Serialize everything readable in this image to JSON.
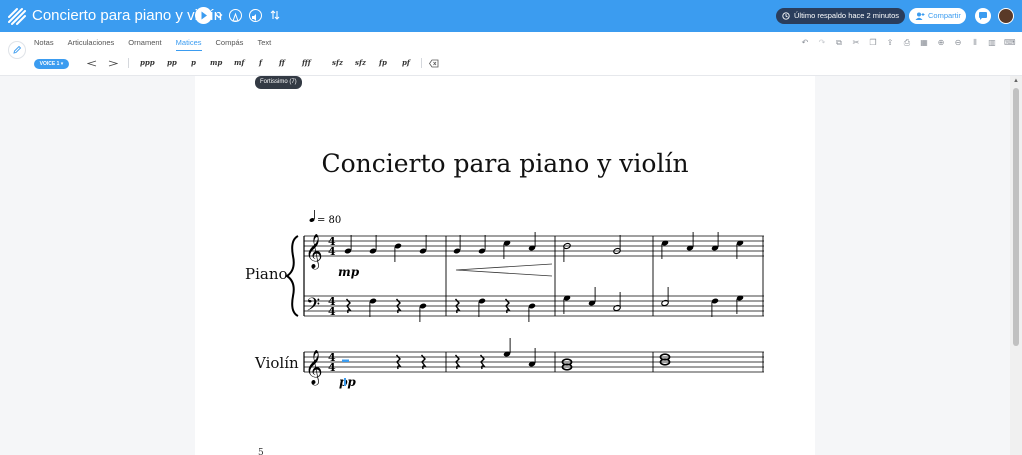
{
  "app": {
    "document_title": "Concierto para piano y violín",
    "backup_status": "Último respaldo hace 2 minutos",
    "share_label": "Compartir"
  },
  "toolbar": {
    "tabs": [
      "Notas",
      "Articulaciones",
      "Ornament",
      "Matices",
      "Compás",
      "Text"
    ],
    "active_tab": "Matices",
    "voice_label": "VOICE 1",
    "dynamics": [
      "ppp",
      "pp",
      "p",
      "mp",
      "mf",
      "f",
      "ff",
      "fff",
      "sfz",
      "sfz",
      "fp",
      "pf"
    ],
    "tooltip": "Fortissimo (7)"
  },
  "score": {
    "title": "Concierto para piano y violín",
    "tempo": "= 80",
    "instruments": [
      "Piano",
      "Violín"
    ],
    "time_signature": "4/4",
    "piano_dynamic": "mp",
    "violin_dynamic": "pp",
    "next_system_measure": "5"
  },
  "icons": {
    "undo": "undo-icon",
    "redo": "redo-icon",
    "copy": "copy-icon",
    "cut": "cut-icon",
    "paste": "paste-icon",
    "export": "export-icon",
    "print": "print-icon",
    "zoom_in": "zoom-in-icon",
    "zoom_out": "zoom-out-icon",
    "layout": "layout-icon"
  },
  "colors": {
    "brand": "#3b9cf0",
    "backup_pill": "#2a3d5c",
    "selection": "#3b9cf0"
  }
}
